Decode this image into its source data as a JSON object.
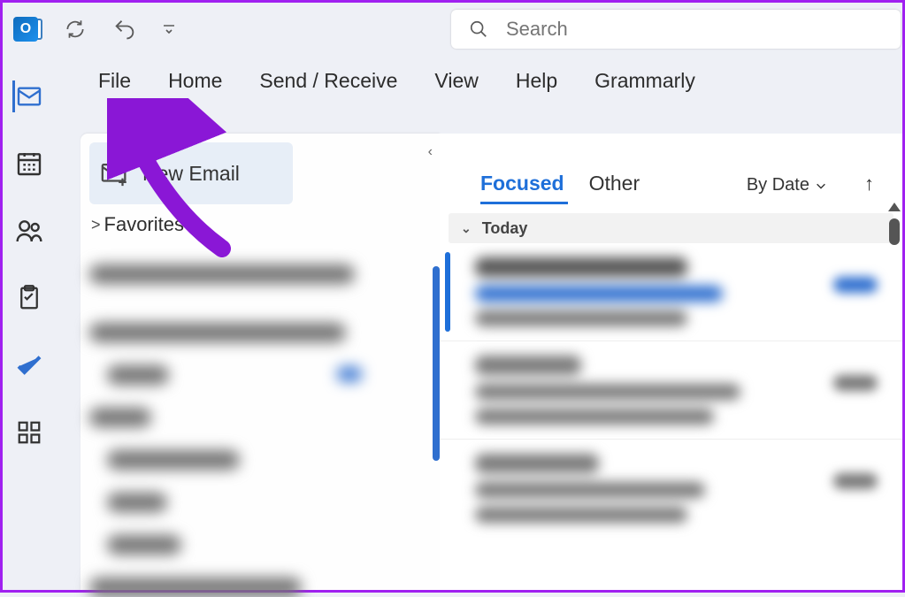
{
  "qat": {
    "logo_letter": "O"
  },
  "search": {
    "placeholder": "Search"
  },
  "ribbon": {
    "file": "File",
    "home": "Home",
    "sendreceive": "Send / Receive",
    "view": "View",
    "help": "Help",
    "grammarly": "Grammarly"
  },
  "nav": {
    "mail": "Mail",
    "calendar": "Calendar",
    "people": "People",
    "tasks": "Tasks",
    "todo": "To Do",
    "apps": "Apps"
  },
  "folders": {
    "new_email": "New Email",
    "favorites": "Favorites"
  },
  "msglist": {
    "focused": "Focused",
    "other": "Other",
    "sortby": "By Date",
    "group_today": "Today"
  }
}
